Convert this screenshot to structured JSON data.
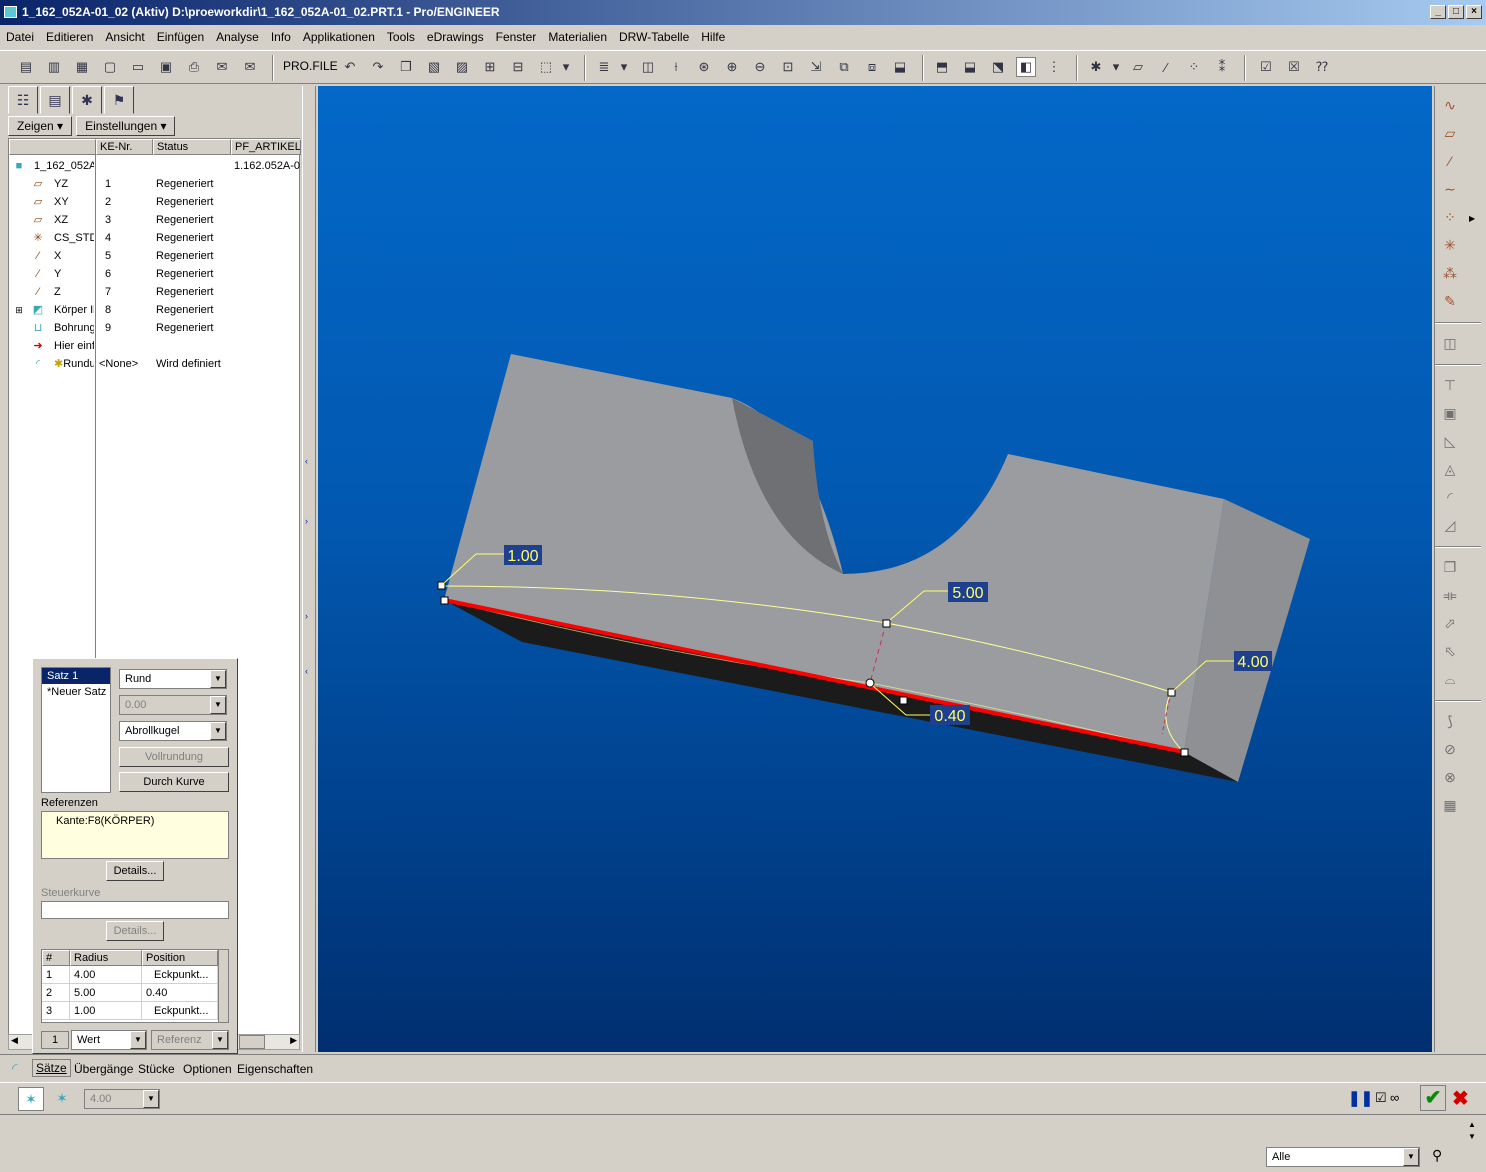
{
  "window": {
    "title": "1_162_052A-01_02 (Aktiv) D:\\proeworkdir\\1_162_052A-01_02.PRT.1 - Pro/ENGINEER"
  },
  "menu": [
    "Datei",
    "Editieren",
    "Ansicht",
    "Einfügen",
    "Analyse",
    "Info",
    "Applikationen",
    "Tools",
    "eDrawings",
    "Fenster",
    "Materialien",
    "DRW-Tabelle",
    "Hilfe"
  ],
  "toolbar": {
    "profile_label": "PRO.FILE"
  },
  "panel": {
    "show_button": "Zeigen",
    "settings_button": "Einstellungen",
    "columns": [
      "KE-Nr.",
      "Status",
      "PF_ARTIKEL"
    ],
    "root": {
      "name": "1_162_052A",
      "pf": "1.162.052A-0"
    },
    "rows": [
      {
        "name": "YZ",
        "nr": "1",
        "status": "Regeneriert",
        "icon": "datum-plane-icon"
      },
      {
        "name": "XY",
        "nr": "2",
        "status": "Regeneriert",
        "icon": "datum-plane-icon"
      },
      {
        "name": "XZ",
        "nr": "3",
        "status": "Regeneriert",
        "icon": "datum-plane-icon"
      },
      {
        "name": "CS_STD",
        "nr": "4",
        "status": "Regeneriert",
        "icon": "coordinate-system-icon"
      },
      {
        "name": "X",
        "nr": "5",
        "status": "Regeneriert",
        "icon": "datum-axis-icon"
      },
      {
        "name": "Y",
        "nr": "6",
        "status": "Regeneriert",
        "icon": "datum-axis-icon"
      },
      {
        "name": "Z",
        "nr": "7",
        "status": "Regeneriert",
        "icon": "datum-axis-icon"
      },
      {
        "name": "Körper Il",
        "nr": "8",
        "status": "Regeneriert",
        "icon": "protrusion-icon"
      },
      {
        "name": "Bohrung",
        "nr": "9",
        "status": "Regeneriert",
        "icon": "hole-icon"
      },
      {
        "name": "Hier einf",
        "nr": "",
        "status": "",
        "icon": "insert-here-arrow-icon"
      },
      {
        "name": "Rundu",
        "nr": "<None>",
        "status": "Wird definiert",
        "icon": "round-icon"
      }
    ]
  },
  "sets_panel": {
    "sets": [
      "Satz 1",
      "*Neuer Satz"
    ],
    "shape_combo": "Rund",
    "value_combo": "0.00",
    "method_combo": "Abrollkugel",
    "full_round_button": "Vollrundung",
    "through_curve_button": "Durch Kurve",
    "references_label": "Referenzen",
    "reference_item": "Kante:F8(KÖRPER)",
    "details_button": "Details...",
    "driving_curve_label": "Steuerkurve",
    "details2_button": "Details...",
    "table_headers": [
      "#",
      "Radius",
      "Position"
    ],
    "table_rows": [
      {
        "n": "1",
        "radius": "4.00",
        "position": "Eckpunkt..."
      },
      {
        "n": "2",
        "radius": "5.00",
        "position": "0.40"
      },
      {
        "n": "3",
        "radius": "1.00",
        "position": "Eckpunkt..."
      }
    ],
    "footer_index": "1",
    "footer_value_combo": "Wert",
    "footer_ref_combo": "Referenz"
  },
  "bottom_tabs": [
    "Sätze",
    "Übergänge",
    "Stücke",
    "Optionen",
    "Eigenschaften"
  ],
  "dashboard": {
    "radius_combo": "4.00"
  },
  "status": {
    "filter_combo": "Alle"
  },
  "viewport": {
    "dimensions": [
      "1.00",
      "5.00",
      "4.00",
      "0.40"
    ],
    "colors": {
      "edge": "#ff0000",
      "label_bg": "#1f3f8f",
      "label_text": "#ffff66",
      "part": "#9a9ca0"
    }
  }
}
